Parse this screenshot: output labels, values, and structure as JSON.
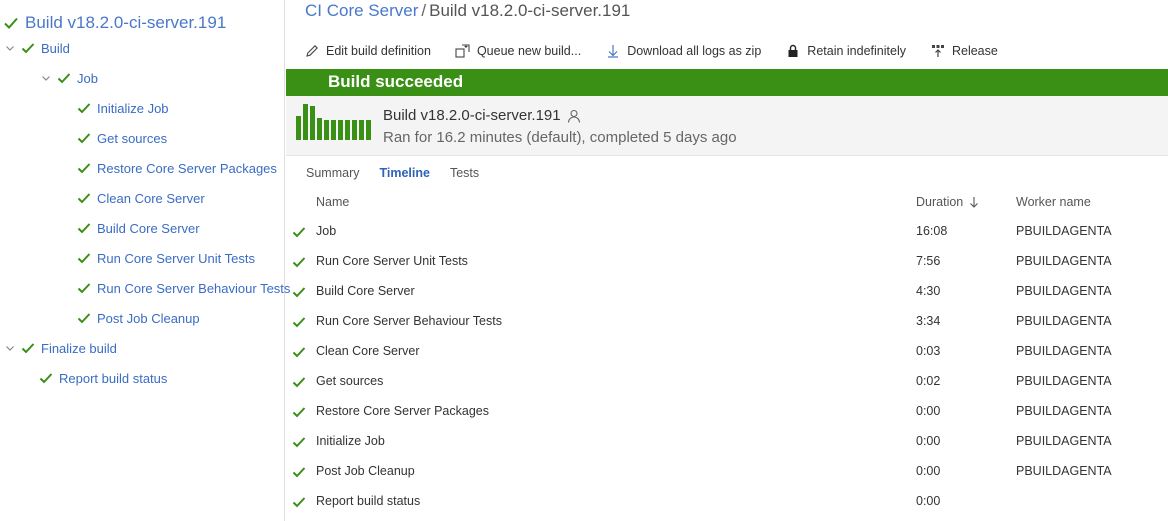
{
  "sidebar": {
    "title": "Build v18.2.0-ci-server.191",
    "items": [
      {
        "label": "Build",
        "level": 1,
        "expandable": true
      },
      {
        "label": "Job",
        "level": 2,
        "expandable": true
      },
      {
        "label": "Initialize Job",
        "level": 3,
        "expandable": false
      },
      {
        "label": "Get sources",
        "level": 3,
        "expandable": false
      },
      {
        "label": "Restore Core Server Packages",
        "level": 3,
        "expandable": false
      },
      {
        "label": "Clean Core Server",
        "level": 3,
        "expandable": false
      },
      {
        "label": "Build Core Server",
        "level": 3,
        "expandable": false
      },
      {
        "label": "Run Core Server Unit Tests",
        "level": 3,
        "expandable": false
      },
      {
        "label": "Run Core Server Behaviour Tests",
        "level": 3,
        "expandable": false
      },
      {
        "label": "Post Job Cleanup",
        "level": 3,
        "expandable": false
      },
      {
        "label": "Finalize build",
        "level": 1,
        "expandable": true
      },
      {
        "label": "Report build status",
        "level": 2,
        "expandable": false
      }
    ]
  },
  "breadcrumb": {
    "project": "CI Core Server",
    "separator": "/",
    "current": "Build v18.2.0-ci-server.191"
  },
  "toolbar": {
    "edit_label": "Edit build definition",
    "queue_label": "Queue new build...",
    "download_label": "Download all logs as zip",
    "retain_label": "Retain indefinitely",
    "release_label": "Release"
  },
  "banner": {
    "text": "Build succeeded",
    "color": "#3a8f15"
  },
  "summary": {
    "title": "Build v18.2.0-ci-server.191",
    "subtitle": "Ran for 16.2 minutes (default), completed 5 days ago",
    "history_bars": [
      0.68,
      1.0,
      0.95,
      0.6,
      0.55,
      0.55,
      0.55,
      0.55,
      0.55,
      0.55,
      0.55
    ]
  },
  "tabs": [
    {
      "label": "Summary",
      "active": false
    },
    {
      "label": "Timeline",
      "active": true
    },
    {
      "label": "Tests",
      "active": false
    }
  ],
  "table": {
    "col_name": "Name",
    "col_duration": "Duration",
    "col_worker": "Worker name",
    "rows": [
      {
        "name": "Job",
        "duration": "16:08",
        "worker": "PBUILDAGENTA"
      },
      {
        "name": "Run Core Server Unit Tests",
        "duration": "7:56",
        "worker": "PBUILDAGENTA"
      },
      {
        "name": "Build Core Server",
        "duration": "4:30",
        "worker": "PBUILDAGENTA"
      },
      {
        "name": "Run Core Server Behaviour Tests",
        "duration": "3:34",
        "worker": "PBUILDAGENTA"
      },
      {
        "name": "Clean Core Server",
        "duration": "0:03",
        "worker": "PBUILDAGENTA"
      },
      {
        "name": "Get sources",
        "duration": "0:02",
        "worker": "PBUILDAGENTA"
      },
      {
        "name": "Restore Core Server Packages",
        "duration": "0:00",
        "worker": "PBUILDAGENTA"
      },
      {
        "name": "Initialize Job",
        "duration": "0:00",
        "worker": "PBUILDAGENTA"
      },
      {
        "name": "Post Job Cleanup",
        "duration": "0:00",
        "worker": "PBUILDAGENTA"
      },
      {
        "name": "Report build status",
        "duration": "0:00",
        "worker": ""
      }
    ]
  },
  "colors": {
    "success_green": "#3a8f15",
    "link_blue": "#3a6cc4"
  },
  "icons": {
    "check": "check-icon",
    "chevron": "chevron-down-icon",
    "edit": "pencil-icon",
    "queue": "queue-icon",
    "download": "download-icon",
    "retain": "lock-icon",
    "release": "release-icon",
    "person": "person-icon",
    "sort": "sort-down-icon"
  }
}
